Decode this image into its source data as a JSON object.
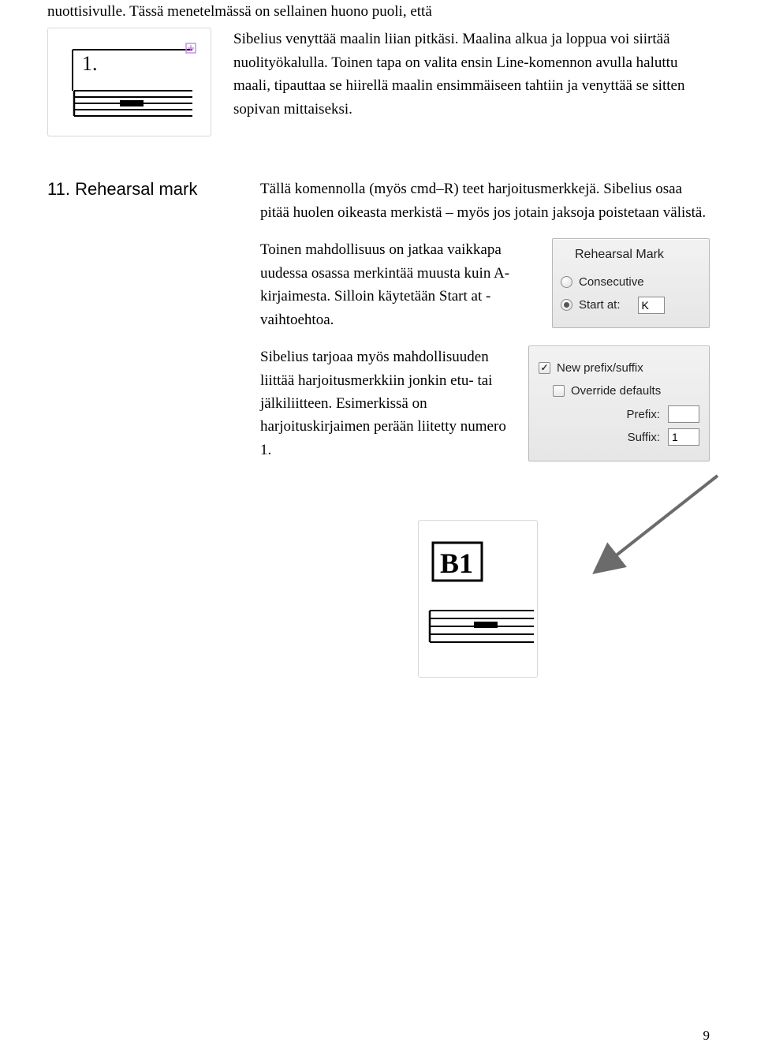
{
  "intro_line": "nuottisivulle. Tässä menetelmässä on sellainen huono puoli, että",
  "top_paragraph": "Sibelius venyttää maalin liian pitkäsi. Maalina alkua ja loppua voi siirtää nuolityökalulla. Toinen tapa on valita ensin Line-komennon avulla haluttu maali, tipauttaa se hiirellä maalin ensimmäiseen tahtiin ja venyttää se sitten sopivan mittaiseksi.",
  "section_heading": "11. Rehearsal mark",
  "para1": "Tällä komennolla (myös cmd–R) teet harjoitusmerkkejä. Sibelius osaa pitää huolen oikeasta merkistä – myös jos jotain jaksoja poistetaan välistä.",
  "para2": "Toinen mahdollisuus on jatkaa vaikkapa uudessa osassa merkintää muusta kuin A-kirjaimesta. Silloin käytetään Start at -vaihtoehtoa.",
  "para3": "Sibelius tarjoaa myös mahdollisuuden liittää harjoitusmerkkiin jonkin etu- tai jälkiliitteen. Esimerkissä on harjoituskirjaimen perään liitetty numero 1.",
  "staff1_label": "1.",
  "b1_label": "B1",
  "dialog1": {
    "title": "Rehearsal Mark",
    "opt_consecutive": "Consecutive",
    "opt_startat": "Start at:",
    "startat_value": "K"
  },
  "dialog2": {
    "check_newprefix": "New prefix/suffix",
    "check_override": "Override defaults",
    "prefix_label": "Prefix:",
    "prefix_value": "",
    "suffix_label": "Suffix:",
    "suffix_value": "1"
  },
  "page_number": "9"
}
